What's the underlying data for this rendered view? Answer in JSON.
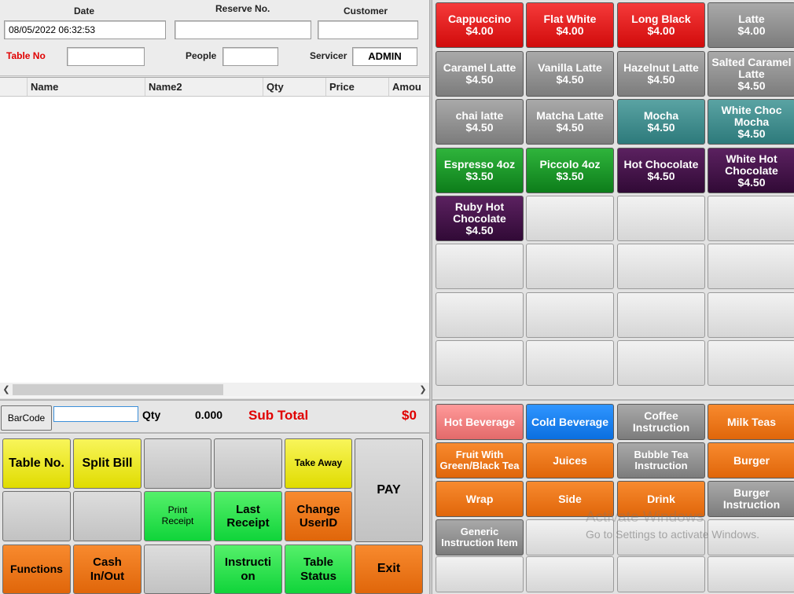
{
  "header": {
    "date_label": "Date",
    "date_value": "08/05/2022 06:32:53",
    "reserve_label": "Reserve No.",
    "reserve_value": "",
    "customer_label": "Customer",
    "customer_value": "",
    "table_label": "Table No",
    "table_value": "",
    "people_label": "People",
    "people_value": "",
    "servicer_label": "Servicer",
    "servicer_value": "ADMIN"
  },
  "grid": {
    "columns": [
      "Name",
      "Name2",
      "Qty",
      "Price",
      "Amou"
    ]
  },
  "subtotal": {
    "barcode_label": "BarCode",
    "barcode_value": "",
    "qty_label": "Qty",
    "qty_value": "0.000",
    "subtotal_label": "Sub Total",
    "subtotal_value": "$0"
  },
  "keypad": {
    "table_no": "Table No.",
    "split_bill": "Split Bill",
    "take_away": "Take Away",
    "pay": "PAY",
    "print_receipt": "Print Receipt",
    "last_receipt": "Last Receipt",
    "change_userid": "Change UserID",
    "functions": "Functions",
    "cash_inout": "Cash In/Out",
    "instruction": "Instructi on",
    "table_status": "Table Status",
    "exit": "Exit"
  },
  "products": [
    {
      "name": "Cappuccino",
      "price": "$4.00",
      "color": "#e31414"
    },
    {
      "name": "Flat White",
      "price": "$4.00",
      "color": "#e31414"
    },
    {
      "name": "Long Black",
      "price": "$4.00",
      "color": "#e31414"
    },
    {
      "name": "Latte",
      "price": "$4.00",
      "color": "#8c8c8c"
    },
    {
      "name": "Caramel Latte",
      "price": "$4.50",
      "color": "#8c8c8c"
    },
    {
      "name": "Vanilla Latte",
      "price": "$4.50",
      "color": "#8c8c8c"
    },
    {
      "name": "Hazelnut Latte",
      "price": "$4.50",
      "color": "#8c8c8c"
    },
    {
      "name": "Salted Caramel Latte",
      "price": "$4.50",
      "color": "#8c8c8c"
    },
    {
      "name": "chai latte",
      "price": "$4.50",
      "color": "#8c8c8c"
    },
    {
      "name": "Matcha Latte",
      "price": "$4.50",
      "color": "#8c8c8c"
    },
    {
      "name": "Mocha",
      "price": "$4.50",
      "color": "#3f8c8d"
    },
    {
      "name": "White Choc Mocha",
      "price": "$4.50",
      "color": "#3f8c8d"
    },
    {
      "name": "Espresso 4oz",
      "price": "$3.50",
      "color": "#1d9a2a"
    },
    {
      "name": "Piccolo 4oz",
      "price": "$3.50",
      "color": "#1d9a2a"
    },
    {
      "name": "Hot Chocolate",
      "price": "$4.50",
      "color": "#44154a"
    },
    {
      "name": "White Hot Chocolate",
      "price": "$4.50",
      "color": "#44154a"
    },
    {
      "name": "Ruby Hot Chocolate",
      "price": "$4.50",
      "color": "#44154a"
    }
  ],
  "categories": [
    {
      "name": "Hot Beverage",
      "color": "#ef7f7f"
    },
    {
      "name": "Cold Beverage",
      "color": "#1f83f5"
    },
    {
      "name": "Coffee Instruction",
      "color": "#8c8c8c"
    },
    {
      "name": "Milk Teas",
      "color": "#ec7a1c"
    },
    {
      "name": "Fruit With Green/Black Tea",
      "color": "#ec7a1c"
    },
    {
      "name": "Juices",
      "color": "#ec7a1c"
    },
    {
      "name": "Bubble Tea Instruction",
      "color": "#8c8c8c"
    },
    {
      "name": "Burger",
      "color": "#ec7a1c"
    },
    {
      "name": "Wrap",
      "color": "#ec7a1c"
    },
    {
      "name": "Side",
      "color": "#ec7a1c"
    },
    {
      "name": "Drink",
      "color": "#ec7a1c"
    },
    {
      "name": "Burger Instruction",
      "color": "#8c8c8c"
    },
    {
      "name": "Generic Instruction Item",
      "color": "#8c8c8c"
    }
  ],
  "watermark": {
    "line1": "Activate Windows",
    "line2": "Go to Settings to activate Windows."
  }
}
